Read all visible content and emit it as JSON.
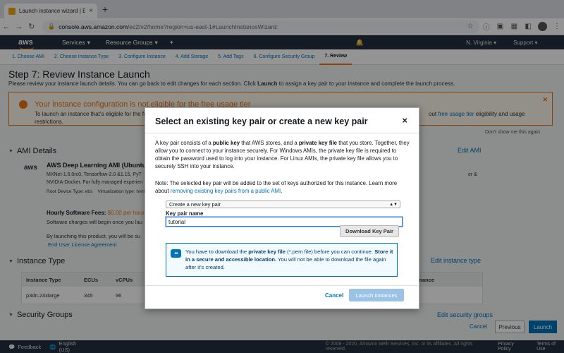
{
  "browser": {
    "tab_title": "Launch instance wizard | EC2 M",
    "url_host": "console.aws.amazon.com",
    "url_path": "/ec2/v2/home?region=us-east-1#LaunchInstanceWizard:",
    "new_tab": "+"
  },
  "awsnav": {
    "logo": "aws",
    "services": "Services",
    "resource_groups": "Resource Groups",
    "region": "N. Virginia",
    "support": "Support"
  },
  "steps": [
    "1. Choose AMI",
    "2. Choose Instance Type",
    "3. Configure Instance",
    "4. Add Storage",
    "5. Add Tags",
    "6. Configure Security Group",
    "7. Review"
  ],
  "page": {
    "title": "Step 7: Review Instance Launch",
    "desc_a": "Please review your instance launch details. You can go back to edit changes for each section. Click ",
    "desc_b": "Launch",
    "desc_c": " to assign a key pair to your instance and complete the launch process."
  },
  "warning": {
    "title": "Your instance configuration is not eligible for the free usage tier",
    "text": "To launch an instance that's eligible for the fr restrictions.",
    "tail_a": "out ",
    "tail_link": "free usage tier",
    "tail_b": " eligibility and usage",
    "dont_show": "Don't show me this again"
  },
  "ami": {
    "heading": "AMI Details",
    "edit": "Edit AMI",
    "logo": "aws",
    "name": "AWS Deep Learning AMI (Ubuntu 16",
    "line1": "MXNet-1.6.0rc0, Tensorflow-2.0 &1.15, PyT",
    "line2": "NVIDIA-Docker. For fully managed experien",
    "line3_a": "Root Device Type: ebs",
    "line3_b": "Virtualization type: hvm",
    "right_text": "er &",
    "fees_label": "Hourly Software Fees:",
    "fees_value": "$0.00 per hour",
    "fees2": "Software charges will begin once you lau",
    "fees3": "By launching this product, you will be su",
    "eula": "End User License Agreement"
  },
  "instance_type": {
    "heading": "Instance Type",
    "edit": "Edit instance type",
    "headers": [
      "Instance Type",
      "ECUs",
      "vCPUs"
    ],
    "row": [
      "p3dn.24xlarge",
      "345",
      "96"
    ],
    "right_header": "s Performance",
    "right_cell": "bit"
  },
  "security": {
    "heading": "Security Groups",
    "edit": "Edit security groups"
  },
  "page_buttons": {
    "cancel": "Cancel",
    "previous": "Previous",
    "launch": "Launch"
  },
  "footer": {
    "feedback": "Feedback",
    "language": "English (US)",
    "copyright": "© 2008 - 2020, Amazon Web Services, Inc. or its affiliates. All rights reserved.",
    "privacy": "Privacy Policy",
    "terms": "Terms of Use"
  },
  "modal": {
    "title": "Select an existing key pair or create a new key pair",
    "close": "×",
    "p1_a": "A key pair consists of a ",
    "p1_b": "public key",
    "p1_c": " that AWS stores, and a ",
    "p1_d": "private key file",
    "p1_e": " that you store. Together, they allow you to connect to your instance securely. For Windows AMIs, the private key file is required to obtain the password used to log into your instance. For Linux AMIs, the private key file allows you to securely SSH into your instance.",
    "p2_a": "Note: The selected key pair will be added to the set of keys authorized for this instance. Learn more about ",
    "p2_link": "removing existing key pairs from a public AMI",
    "p2_b": ".",
    "select_value": "Create a new key pair",
    "key_pair_label": "Key pair name",
    "key_pair_value": "tutorial",
    "download_button": "Download Key Pair",
    "info_a": "You have to download the ",
    "info_b": "private key file",
    "info_c": " (*.pem file) before you can continue. ",
    "info_d": "Store it in a secure and accessible location.",
    "info_e": " You will not be able to download the file again after it's created.",
    "cancel": "Cancel",
    "launch": "Launch Instances"
  }
}
